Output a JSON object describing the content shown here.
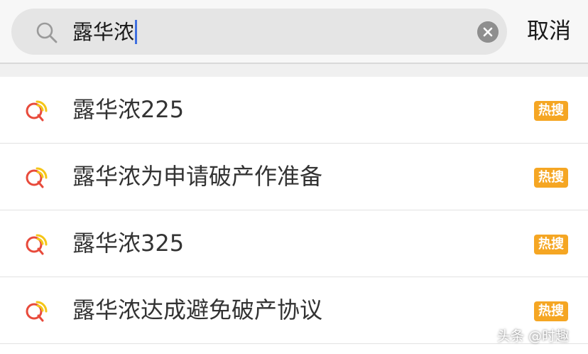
{
  "search": {
    "query": "露华浓",
    "cancel_label": "取消",
    "search_icon": "search-icon",
    "clear_icon": "clear-icon"
  },
  "colors": {
    "caret": "#3f6fe0",
    "hot_badge": "#f5a623",
    "icon_red": "#e84a3b",
    "icon_yellow": "#f5c518"
  },
  "suggestions": [
    {
      "text": "露华浓225",
      "badge": "热搜"
    },
    {
      "text": "露华浓为申请破产作准备",
      "badge": "热搜"
    },
    {
      "text": "露华浓325",
      "badge": "热搜"
    },
    {
      "text": "露华浓达成避免破产协议",
      "badge": "热搜"
    }
  ],
  "watermark": "头条 @时趣"
}
